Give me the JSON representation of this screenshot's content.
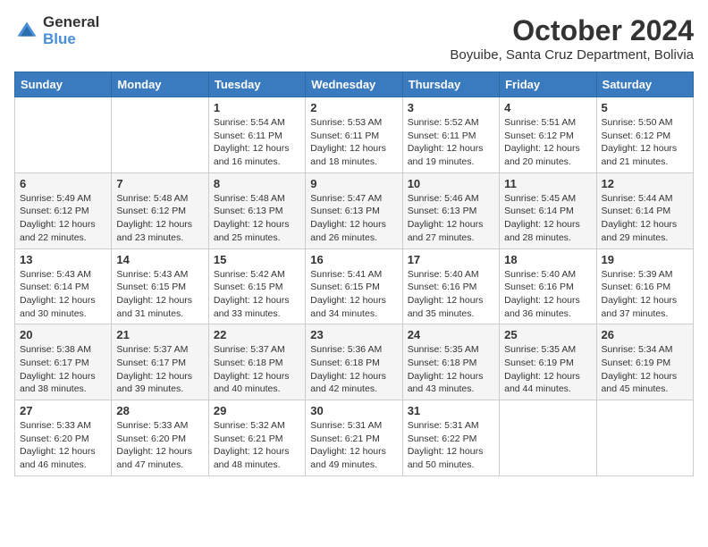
{
  "logo": {
    "general": "General",
    "blue": "Blue"
  },
  "title": "October 2024",
  "location": "Boyuibe, Santa Cruz Department, Bolivia",
  "weekdays": [
    "Sunday",
    "Monday",
    "Tuesday",
    "Wednesday",
    "Thursday",
    "Friday",
    "Saturday"
  ],
  "weeks": [
    [
      {
        "day": null,
        "info": null
      },
      {
        "day": null,
        "info": null
      },
      {
        "day": "1",
        "info": "Sunrise: 5:54 AM\nSunset: 6:11 PM\nDaylight: 12 hours and 16 minutes."
      },
      {
        "day": "2",
        "info": "Sunrise: 5:53 AM\nSunset: 6:11 PM\nDaylight: 12 hours and 18 minutes."
      },
      {
        "day": "3",
        "info": "Sunrise: 5:52 AM\nSunset: 6:11 PM\nDaylight: 12 hours and 19 minutes."
      },
      {
        "day": "4",
        "info": "Sunrise: 5:51 AM\nSunset: 6:12 PM\nDaylight: 12 hours and 20 minutes."
      },
      {
        "day": "5",
        "info": "Sunrise: 5:50 AM\nSunset: 6:12 PM\nDaylight: 12 hours and 21 minutes."
      }
    ],
    [
      {
        "day": "6",
        "info": "Sunrise: 5:49 AM\nSunset: 6:12 PM\nDaylight: 12 hours and 22 minutes."
      },
      {
        "day": "7",
        "info": "Sunrise: 5:48 AM\nSunset: 6:12 PM\nDaylight: 12 hours and 23 minutes."
      },
      {
        "day": "8",
        "info": "Sunrise: 5:48 AM\nSunset: 6:13 PM\nDaylight: 12 hours and 25 minutes."
      },
      {
        "day": "9",
        "info": "Sunrise: 5:47 AM\nSunset: 6:13 PM\nDaylight: 12 hours and 26 minutes."
      },
      {
        "day": "10",
        "info": "Sunrise: 5:46 AM\nSunset: 6:13 PM\nDaylight: 12 hours and 27 minutes."
      },
      {
        "day": "11",
        "info": "Sunrise: 5:45 AM\nSunset: 6:14 PM\nDaylight: 12 hours and 28 minutes."
      },
      {
        "day": "12",
        "info": "Sunrise: 5:44 AM\nSunset: 6:14 PM\nDaylight: 12 hours and 29 minutes."
      }
    ],
    [
      {
        "day": "13",
        "info": "Sunrise: 5:43 AM\nSunset: 6:14 PM\nDaylight: 12 hours and 30 minutes."
      },
      {
        "day": "14",
        "info": "Sunrise: 5:43 AM\nSunset: 6:15 PM\nDaylight: 12 hours and 31 minutes."
      },
      {
        "day": "15",
        "info": "Sunrise: 5:42 AM\nSunset: 6:15 PM\nDaylight: 12 hours and 33 minutes."
      },
      {
        "day": "16",
        "info": "Sunrise: 5:41 AM\nSunset: 6:15 PM\nDaylight: 12 hours and 34 minutes."
      },
      {
        "day": "17",
        "info": "Sunrise: 5:40 AM\nSunset: 6:16 PM\nDaylight: 12 hours and 35 minutes."
      },
      {
        "day": "18",
        "info": "Sunrise: 5:40 AM\nSunset: 6:16 PM\nDaylight: 12 hours and 36 minutes."
      },
      {
        "day": "19",
        "info": "Sunrise: 5:39 AM\nSunset: 6:16 PM\nDaylight: 12 hours and 37 minutes."
      }
    ],
    [
      {
        "day": "20",
        "info": "Sunrise: 5:38 AM\nSunset: 6:17 PM\nDaylight: 12 hours and 38 minutes."
      },
      {
        "day": "21",
        "info": "Sunrise: 5:37 AM\nSunset: 6:17 PM\nDaylight: 12 hours and 39 minutes."
      },
      {
        "day": "22",
        "info": "Sunrise: 5:37 AM\nSunset: 6:18 PM\nDaylight: 12 hours and 40 minutes."
      },
      {
        "day": "23",
        "info": "Sunrise: 5:36 AM\nSunset: 6:18 PM\nDaylight: 12 hours and 42 minutes."
      },
      {
        "day": "24",
        "info": "Sunrise: 5:35 AM\nSunset: 6:18 PM\nDaylight: 12 hours and 43 minutes."
      },
      {
        "day": "25",
        "info": "Sunrise: 5:35 AM\nSunset: 6:19 PM\nDaylight: 12 hours and 44 minutes."
      },
      {
        "day": "26",
        "info": "Sunrise: 5:34 AM\nSunset: 6:19 PM\nDaylight: 12 hours and 45 minutes."
      }
    ],
    [
      {
        "day": "27",
        "info": "Sunrise: 5:33 AM\nSunset: 6:20 PM\nDaylight: 12 hours and 46 minutes."
      },
      {
        "day": "28",
        "info": "Sunrise: 5:33 AM\nSunset: 6:20 PM\nDaylight: 12 hours and 47 minutes."
      },
      {
        "day": "29",
        "info": "Sunrise: 5:32 AM\nSunset: 6:21 PM\nDaylight: 12 hours and 48 minutes."
      },
      {
        "day": "30",
        "info": "Sunrise: 5:31 AM\nSunset: 6:21 PM\nDaylight: 12 hours and 49 minutes."
      },
      {
        "day": "31",
        "info": "Sunrise: 5:31 AM\nSunset: 6:22 PM\nDaylight: 12 hours and 50 minutes."
      },
      {
        "day": null,
        "info": null
      },
      {
        "day": null,
        "info": null
      }
    ]
  ]
}
